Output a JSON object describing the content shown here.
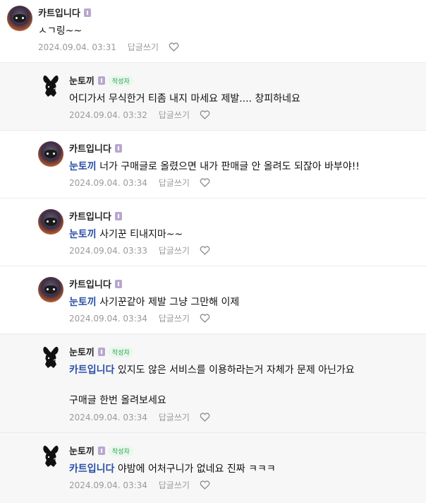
{
  "comments": [
    {
      "nick": "카트입니다",
      "author": false,
      "mention": "",
      "text": "ㅅㄱ링~~",
      "date": "2024.09.04. 03:31",
      "reply_label": "답글쓰기"
    },
    {
      "nick": "눈토끼",
      "author": true,
      "author_label": "작성자",
      "mention": "",
      "text": "어디가서 무식한거 티좀 내지 마세요 제발.... 창피하네요",
      "date": "2024.09.04. 03:32",
      "reply_label": "답글쓰기"
    },
    {
      "nick": "카트입니다",
      "author": false,
      "mention": "눈토끼",
      "text": "너가 구매글로 올렸으면 내가 판매글 안 올려도 되잖아 바부야!!",
      "date": "2024.09.04. 03:34",
      "reply_label": "답글쓰기"
    },
    {
      "nick": "카트입니다",
      "author": false,
      "mention": "눈토끼",
      "text": "사기꾼 티내지마~~",
      "date": "2024.09.04. 03:33",
      "reply_label": "답글쓰기"
    },
    {
      "nick": "카트입니다",
      "author": false,
      "mention": "눈토끼",
      "text": "사기꾼같아 제발 그냥 그만해 이제",
      "date": "2024.09.04. 03:34",
      "reply_label": "답글쓰기"
    },
    {
      "nick": "눈토끼",
      "author": true,
      "author_label": "작성자",
      "mention": "카트입니다",
      "text": "있지도 않은 서비스를 이용하라는거 자체가 문제 아닌가요",
      "text2": "구매글 한번 올려보세요",
      "date": "2024.09.04. 03:34",
      "reply_label": "답글쓰기"
    },
    {
      "nick": "눈토끼",
      "author": true,
      "author_label": "작성자",
      "mention": "카트입니다",
      "text": "야밤에 어처구니가 없네요 진짜 ㅋㅋㅋ",
      "date": "2024.09.04. 03:34",
      "reply_label": "답글쓰기"
    }
  ]
}
